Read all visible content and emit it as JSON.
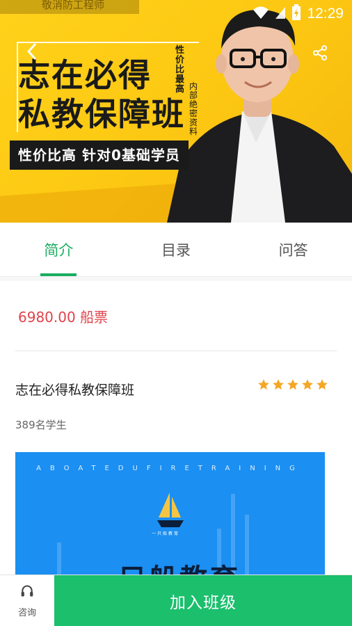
{
  "status_bar": {
    "time": "12:29"
  },
  "hero": {
    "faded_top_text": "敬消防工程师",
    "title_line1": "志在必得",
    "title_line2": "私教保障班",
    "vertical_text_1": "性价比最高",
    "vertical_text_2": "内部绝密资料",
    "slogan": "性价比高 针对0基础学员"
  },
  "tabs": [
    {
      "label": "简介",
      "active": true
    },
    {
      "label": "目录",
      "active": false
    },
    {
      "label": "问答",
      "active": false
    }
  ],
  "course": {
    "price": "6980.00 船票",
    "title": "志在必得私教保障班",
    "rating": 5,
    "students": "389名学生"
  },
  "promo": {
    "letters": "ABOATEDUFIRETRAINING",
    "logo_text": "一只船教育",
    "headline": "只船教育"
  },
  "bottom_bar": {
    "consult_label": "咨询",
    "join_label": "加入班级"
  },
  "colors": {
    "accent_green": "#1aad60",
    "join_button": "#1bbf6c",
    "price_red": "#e0424a",
    "star_orange": "#f5a623",
    "promo_blue": "#1b8ff2"
  }
}
